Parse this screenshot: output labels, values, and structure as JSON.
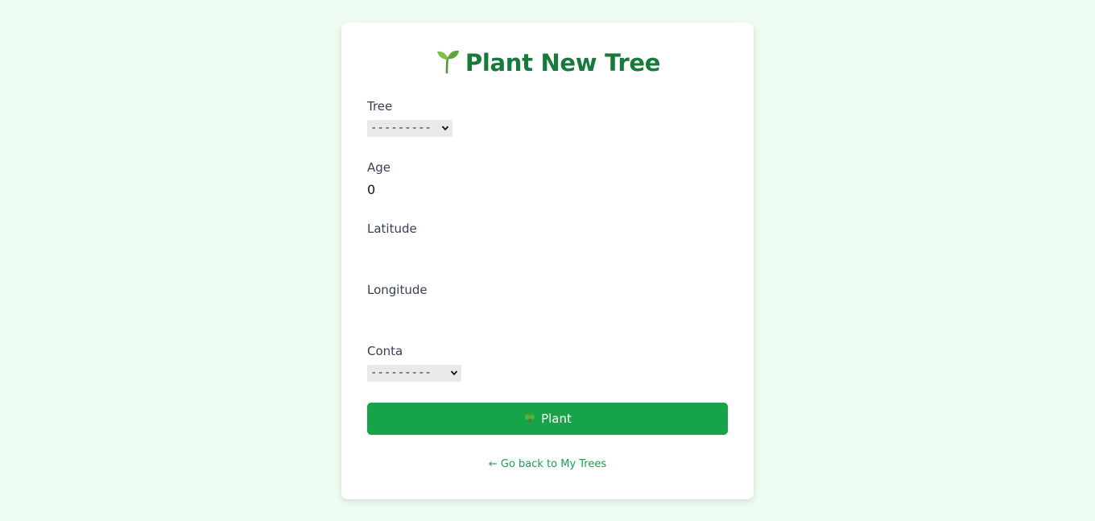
{
  "page": {
    "title": "Plant New Tree",
    "title_icon": "sprout-icon",
    "colors": {
      "background": "#effcf2",
      "accent": "#16a34a",
      "title": "#157a3a"
    }
  },
  "form": {
    "tree": {
      "label": "Tree",
      "selected": "---------"
    },
    "age": {
      "label": "Age",
      "value": "0"
    },
    "latitude": {
      "label": "Latitude",
      "value": ""
    },
    "longitude": {
      "label": "Longitude",
      "value": ""
    },
    "conta": {
      "label": "Conta",
      "selected": "---------"
    },
    "submit": {
      "label": "Plant",
      "icon": "tree-icon"
    }
  },
  "back_link": {
    "label": "← Go back to My Trees"
  }
}
